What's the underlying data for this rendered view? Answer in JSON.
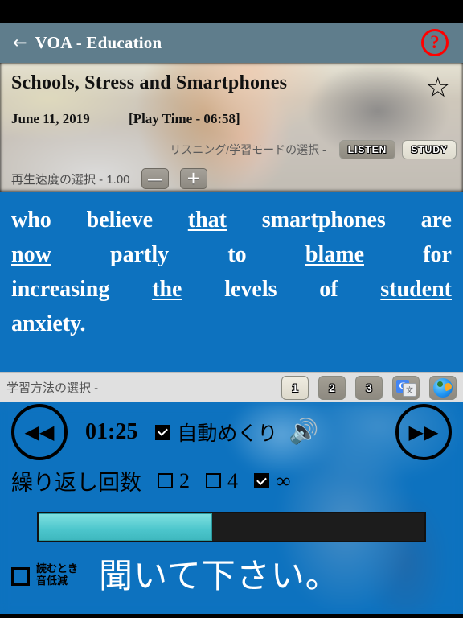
{
  "header": {
    "back_icon": "back-arrow-icon",
    "title": "VOA - Education",
    "help_label": "?"
  },
  "article": {
    "title": "Schools, Stress and Smartphones",
    "date": "June 11, 2019",
    "play_time": "[Play Time - 06:58]",
    "favorite_icon": "☆"
  },
  "mode": {
    "label": "リスニング/学習モードの選択 -",
    "listen_label": "LISTEN",
    "study_label": "STUDY",
    "selected": "LISTEN"
  },
  "speed": {
    "label": "再生速度の選択 - 1.00",
    "value": "1.00",
    "minus_label": "—",
    "plus_label": "＋"
  },
  "transcript": {
    "lines": [
      [
        {
          "text": "who",
          "underline": false
        },
        {
          "text": "believe",
          "underline": false
        },
        {
          "text": "that",
          "underline": true
        },
        {
          "text": "smartphones",
          "underline": false
        },
        {
          "text": "are",
          "underline": false
        }
      ],
      [
        {
          "text": "now",
          "underline": true
        },
        {
          "text": "partly",
          "underline": false
        },
        {
          "text": "to",
          "underline": false
        },
        {
          "text": "blame",
          "underline": true
        },
        {
          "text": "for",
          "underline": false
        }
      ],
      [
        {
          "text": "increasing",
          "underline": false
        },
        {
          "text": "the",
          "underline": true
        },
        {
          "text": "levels",
          "underline": false
        },
        {
          "text": "of",
          "underline": false
        },
        {
          "text": "student",
          "underline": true
        }
      ],
      [
        {
          "text": "anxiety.",
          "underline": false
        }
      ]
    ]
  },
  "study": {
    "label": "学習方法の選択 -",
    "buttons": [
      {
        "label": "1",
        "selected": true
      },
      {
        "label": "2",
        "selected": false
      },
      {
        "label": "3",
        "selected": false
      }
    ],
    "translate_icon": "google-translate-icon",
    "translate_glyph": "G",
    "translate_sub": "文",
    "parrot_icon": "parrot-icon"
  },
  "player": {
    "rewind_icon": "◀◀",
    "forward_icon": "▶▶",
    "elapsed": "01:25",
    "autoflip_label": "自動めくり",
    "autoflip_checked": true,
    "speaker_icon": "🔊",
    "repeat_label": "繰り返し回数",
    "repeat_options": [
      {
        "label": "2",
        "checked": false
      },
      {
        "label": "4",
        "checked": false
      },
      {
        "label": "∞",
        "checked": true
      }
    ],
    "progress_percent": 45,
    "lower_checkbox_label_line1": "読むとき",
    "lower_checkbox_label_line2": "音低減",
    "lower_checkbox_checked": false,
    "status_message": "聞いて下さい。"
  },
  "colors": {
    "header_bg": "#5f7d8c",
    "accent_blue": "#0d72bf",
    "progress_fill": "#4cc6cc",
    "help_red": "#ff0000",
    "study_bar_bg": "#e0e0e0"
  }
}
